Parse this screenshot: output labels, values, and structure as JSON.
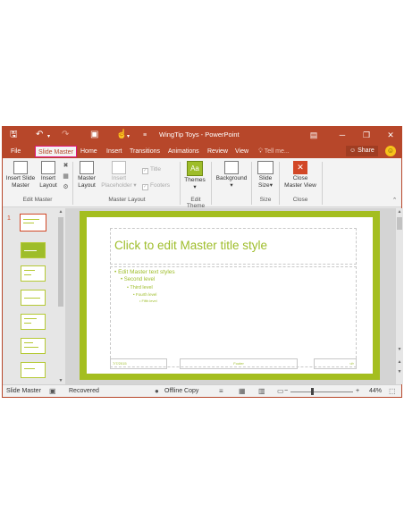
{
  "window": {
    "title": "WingTip Toys - PowerPoint",
    "accent_color": "#b7472a",
    "qat_icons": [
      "save-icon",
      "undo-icon",
      "redo-icon",
      "start-from-beginning-icon",
      "touch-mode-icon",
      "customize-qat-icon"
    ],
    "controls": [
      "ribbon-display-options-icon",
      "minimize-icon",
      "restore-icon",
      "close-icon"
    ]
  },
  "tabs": {
    "file": "File",
    "slide_master": "Slide Master",
    "home": "Home",
    "insert": "Insert",
    "transitions": "Transitions",
    "animations": "Animations",
    "review": "Review",
    "view": "View",
    "tell_me": "Tell me...",
    "share": "Share",
    "active": "Slide Master"
  },
  "ribbon": {
    "insert_slide_master": [
      "Insert Slide",
      "Master"
    ],
    "insert_layout": [
      "Insert",
      "Layout"
    ],
    "edit_master_label": "Edit Master",
    "master_layout": [
      "Master",
      "Layout"
    ],
    "insert_placeholder": [
      "Insert",
      "Placeholder"
    ],
    "title_check": "Title",
    "footers_check": "Footers",
    "master_layout_label": "Master Layout",
    "themes": "Themes",
    "edit_theme_label": "Edit Theme",
    "background": "Background",
    "slide_size": [
      "Slide",
      "Size"
    ],
    "size_label": "Size",
    "close_master_view": [
      "Close",
      "Master View"
    ],
    "close_label": "Close"
  },
  "thumbnails": {
    "selected_number": "1",
    "count_visible": 8
  },
  "slide": {
    "title": "Click to edit Master title style",
    "levels": [
      "Edit Master text styles",
      "Second level",
      "Third level",
      "Fourth level",
      "Fifth level"
    ],
    "footer_left": "7/7/2015",
    "footer_center": "Footer",
    "footer_right": "‹#›",
    "theme_color": "#a4be1f"
  },
  "status": {
    "view": "Slide Master",
    "recovered": "Recovered",
    "offline": "Offline Copy",
    "zoom": "44%"
  }
}
